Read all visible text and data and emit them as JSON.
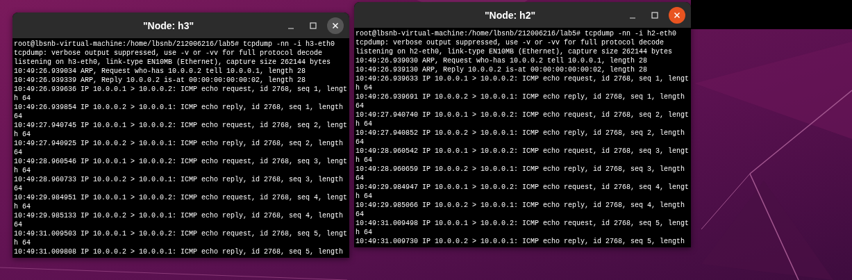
{
  "windows": [
    {
      "title": "\"Node: h3\"",
      "active": false,
      "lines": [
        "root@lbsnb-virtual-machine:/home/lbsnb/212006216/lab5# tcpdump -nn -i h3-eth0",
        "tcpdump: verbose output suppressed, use -v or -vv for full protocol decode",
        "listening on h3-eth0, link-type EN10MB (Ethernet), capture size 262144 bytes",
        "10:49:26.939034 ARP, Request who-has 10.0.0.2 tell 10.0.0.1, length 28",
        "10:49:26.939339 ARP, Reply 10.0.0.2 is-at 00:00:00:00:00:02, length 28",
        "10:49:26.939636 IP 10.0.0.1 > 10.0.0.2: ICMP echo request, id 2768, seq 1, lengt",
        "h 64",
        "10:49:26.939854 IP 10.0.0.2 > 10.0.0.1: ICMP echo reply, id 2768, seq 1, length",
        "64",
        "10:49:27.940745 IP 10.0.0.1 > 10.0.0.2: ICMP echo request, id 2768, seq 2, lengt",
        "h 64",
        "10:49:27.940925 IP 10.0.0.2 > 10.0.0.1: ICMP echo reply, id 2768, seq 2, length",
        "64",
        "10:49:28.960546 IP 10.0.0.1 > 10.0.0.2: ICMP echo request, id 2768, seq 3, lengt",
        "h 64",
        "10:49:28.960733 IP 10.0.0.2 > 10.0.0.1: ICMP echo reply, id 2768, seq 3, length",
        "64",
        "10:49:29.984951 IP 10.0.0.1 > 10.0.0.2: ICMP echo request, id 2768, seq 4, lengt",
        "h 64",
        "10:49:29.985133 IP 10.0.0.2 > 10.0.0.1: ICMP echo reply, id 2768, seq 4, length",
        "64",
        "10:49:31.009503 IP 10.0.0.1 > 10.0.0.2: ICMP echo request, id 2768, seq 5, lengt",
        "h 64",
        "10:49:31.009808 IP 10.0.0.2 > 10.0.0.1: ICMP echo reply, id 2768, seq 5, length"
      ]
    },
    {
      "title": "\"Node: h2\"",
      "active": true,
      "lines": [
        "root@lbsnb-virtual-machine:/home/lbsnb/212006216/lab5# tcpdump -nn -i h2-eth0",
        "tcpdump: verbose output suppressed, use -v or -vv for full protocol decode",
        "listening on h2-eth0, link-type EN10MB (Ethernet), capture size 262144 bytes",
        "10:49:26.939030 ARP, Request who-has 10.0.0.2 tell 10.0.0.1, length 28",
        "10:49:26.939130 ARP, Reply 10.0.0.2 is-at 00:00:00:00:00:02, length 28",
        "10:49:26.939633 IP 10.0.0.1 > 10.0.0.2: ICMP echo request, id 2768, seq 1, lengt",
        "h 64",
        "10:49:26.939691 IP 10.0.0.2 > 10.0.0.1: ICMP echo reply, id 2768, seq 1, length",
        "64",
        "10:49:27.940740 IP 10.0.0.1 > 10.0.0.2: ICMP echo request, id 2768, seq 2, lengt",
        "h 64",
        "10:49:27.940852 IP 10.0.0.2 > 10.0.0.1: ICMP echo reply, id 2768, seq 2, length",
        "64",
        "10:49:28.960542 IP 10.0.0.1 > 10.0.0.2: ICMP echo request, id 2768, seq 3, lengt",
        "h 64",
        "10:49:28.960659 IP 10.0.0.2 > 10.0.0.1: ICMP echo reply, id 2768, seq 3, length",
        "64",
        "10:49:29.984947 IP 10.0.0.1 > 10.0.0.2: ICMP echo request, id 2768, seq 4, lengt",
        "h 64",
        "10:49:29.985066 IP 10.0.0.2 > 10.0.0.1: ICMP echo reply, id 2768, seq 4, length",
        "64",
        "10:49:31.009498 IP 10.0.0.1 > 10.0.0.2: ICMP echo request, id 2768, seq 5, lengt",
        "h 64",
        "10:49:31.009730 IP 10.0.0.2 > 10.0.0.1: ICMP echo reply, id 2768, seq 5, length"
      ]
    }
  ]
}
